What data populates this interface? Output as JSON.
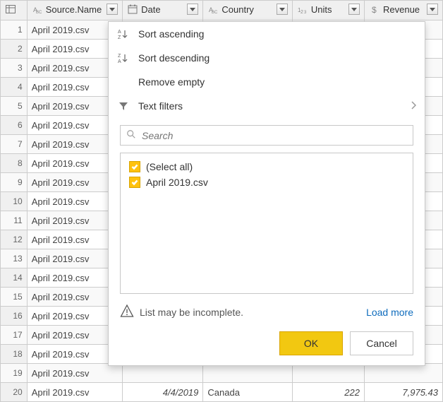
{
  "headers": {
    "source": "Source.Name",
    "date": "Date",
    "country": "Country",
    "units": "Units",
    "revenue": "Revenue"
  },
  "rows": [
    {
      "n": "1",
      "source": "April 2019.csv",
      "date": "",
      "country": "",
      "units": "",
      "revenue": ""
    },
    {
      "n": "2",
      "source": "April 2019.csv",
      "date": "",
      "country": "",
      "units": "",
      "revenue": ""
    },
    {
      "n": "3",
      "source": "April 2019.csv",
      "date": "",
      "country": "",
      "units": "",
      "revenue": ""
    },
    {
      "n": "4",
      "source": "April 2019.csv",
      "date": "",
      "country": "",
      "units": "",
      "revenue": ""
    },
    {
      "n": "5",
      "source": "April 2019.csv",
      "date": "",
      "country": "",
      "units": "",
      "revenue": ""
    },
    {
      "n": "6",
      "source": "April 2019.csv",
      "date": "",
      "country": "",
      "units": "",
      "revenue": ""
    },
    {
      "n": "7",
      "source": "April 2019.csv",
      "date": "",
      "country": "",
      "units": "",
      "revenue": ""
    },
    {
      "n": "8",
      "source": "April 2019.csv",
      "date": "",
      "country": "",
      "units": "",
      "revenue": ""
    },
    {
      "n": "9",
      "source": "April 2019.csv",
      "date": "",
      "country": "",
      "units": "",
      "revenue": ""
    },
    {
      "n": "10",
      "source": "April 2019.csv",
      "date": "",
      "country": "",
      "units": "",
      "revenue": ""
    },
    {
      "n": "11",
      "source": "April 2019.csv",
      "date": "",
      "country": "",
      "units": "",
      "revenue": ""
    },
    {
      "n": "12",
      "source": "April 2019.csv",
      "date": "",
      "country": "",
      "units": "",
      "revenue": ""
    },
    {
      "n": "13",
      "source": "April 2019.csv",
      "date": "",
      "country": "",
      "units": "",
      "revenue": ""
    },
    {
      "n": "14",
      "source": "April 2019.csv",
      "date": "",
      "country": "",
      "units": "",
      "revenue": ""
    },
    {
      "n": "15",
      "source": "April 2019.csv",
      "date": "",
      "country": "",
      "units": "",
      "revenue": ""
    },
    {
      "n": "16",
      "source": "April 2019.csv",
      "date": "",
      "country": "",
      "units": "",
      "revenue": ""
    },
    {
      "n": "17",
      "source": "April 2019.csv",
      "date": "",
      "country": "",
      "units": "",
      "revenue": ""
    },
    {
      "n": "18",
      "source": "April 2019.csv",
      "date": "",
      "country": "",
      "units": "",
      "revenue": ""
    },
    {
      "n": "19",
      "source": "April 2019.csv",
      "date": "",
      "country": "",
      "units": "",
      "revenue": ""
    },
    {
      "n": "20",
      "source": "April 2019.csv",
      "date": "4/4/2019",
      "country": "Canada",
      "units": "222",
      "revenue": "7,975.43"
    }
  ],
  "dropdown": {
    "sort_asc": "Sort ascending",
    "sort_desc": "Sort descending",
    "remove_empty": "Remove empty",
    "text_filters": "Text filters",
    "search_placeholder": "Search",
    "select_all": "(Select all)",
    "options": [
      "April 2019.csv"
    ],
    "incomplete_msg": "List may be incomplete.",
    "load_more": "Load more",
    "ok": "OK",
    "cancel": "Cancel"
  }
}
